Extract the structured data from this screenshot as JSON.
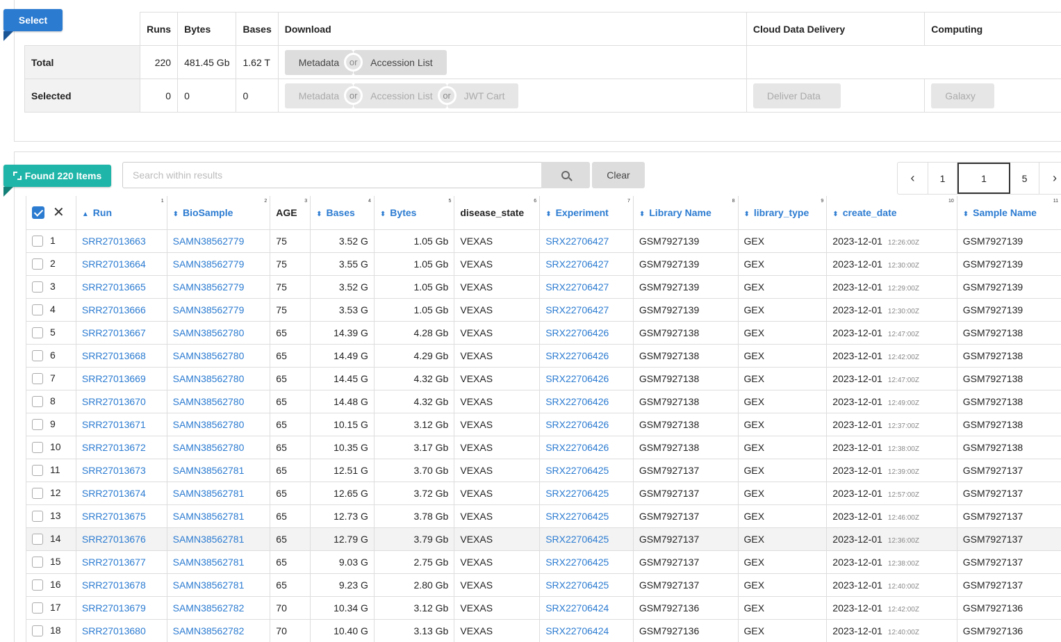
{
  "select_ribbon": "Select",
  "summary": {
    "headers": {
      "runs": "Runs",
      "bytes": "Bytes",
      "bases": "Bases",
      "download": "Download",
      "cloud": "Cloud Data Delivery",
      "computing": "Computing"
    },
    "total": {
      "label": "Total",
      "runs": "220",
      "bytes": "481.45 Gb",
      "bases": "1.62 T",
      "metadata": "Metadata",
      "or": "or",
      "accession": "Accession List"
    },
    "selected": {
      "label": "Selected",
      "runs": "0",
      "bytes": "0",
      "bases": "0",
      "metadata": "Metadata",
      "or1": "or",
      "accession": "Accession List",
      "or2": "or",
      "jwt": "JWT Cart",
      "deliver": "Deliver Data",
      "galaxy": "Galaxy"
    }
  },
  "found_ribbon": "Found 220 Items",
  "search": {
    "placeholder": "Search within results",
    "clear": "Clear"
  },
  "pager": {
    "prev": "‹",
    "first": "1",
    "current": "1",
    "last": "5",
    "next": "›"
  },
  "columns": [
    {
      "label": "Run",
      "num": "1"
    },
    {
      "label": "BioSample",
      "num": "2"
    },
    {
      "label": "AGE",
      "num": "3"
    },
    {
      "label": "Bases",
      "num": "4"
    },
    {
      "label": "Bytes",
      "num": "5"
    },
    {
      "label": "disease_state",
      "num": "6"
    },
    {
      "label": "Experiment",
      "num": "7"
    },
    {
      "label": "Library Name",
      "num": "8"
    },
    {
      "label": "library_type",
      "num": "9"
    },
    {
      "label": "create_date",
      "num": "10"
    },
    {
      "label": "Sample Name",
      "num": "11"
    }
  ],
  "rows": [
    {
      "n": "1",
      "run": "SRR27013663",
      "bio": "SAMN38562779",
      "age": "75",
      "bases": "3.52 G",
      "bytes": "1.05 Gb",
      "disease": "VEXAS",
      "exp": "SRX22706427",
      "lib": "GSM7927139",
      "type": "GEX",
      "date": "2023-12-01",
      "time": "12:26:00Z",
      "sample": "GSM7927139"
    },
    {
      "n": "2",
      "run": "SRR27013664",
      "bio": "SAMN38562779",
      "age": "75",
      "bases": "3.55 G",
      "bytes": "1.05 Gb",
      "disease": "VEXAS",
      "exp": "SRX22706427",
      "lib": "GSM7927139",
      "type": "GEX",
      "date": "2023-12-01",
      "time": "12:30:00Z",
      "sample": "GSM7927139"
    },
    {
      "n": "3",
      "run": "SRR27013665",
      "bio": "SAMN38562779",
      "age": "75",
      "bases": "3.52 G",
      "bytes": "1.05 Gb",
      "disease": "VEXAS",
      "exp": "SRX22706427",
      "lib": "GSM7927139",
      "type": "GEX",
      "date": "2023-12-01",
      "time": "12:29:00Z",
      "sample": "GSM7927139"
    },
    {
      "n": "4",
      "run": "SRR27013666",
      "bio": "SAMN38562779",
      "age": "75",
      "bases": "3.53 G",
      "bytes": "1.05 Gb",
      "disease": "VEXAS",
      "exp": "SRX22706427",
      "lib": "GSM7927139",
      "type": "GEX",
      "date": "2023-12-01",
      "time": "12:30:00Z",
      "sample": "GSM7927139"
    },
    {
      "n": "5",
      "run": "SRR27013667",
      "bio": "SAMN38562780",
      "age": "65",
      "bases": "14.39 G",
      "bytes": "4.28 Gb",
      "disease": "VEXAS",
      "exp": "SRX22706426",
      "lib": "GSM7927138",
      "type": "GEX",
      "date": "2023-12-01",
      "time": "12:47:00Z",
      "sample": "GSM7927138"
    },
    {
      "n": "6",
      "run": "SRR27013668",
      "bio": "SAMN38562780",
      "age": "65",
      "bases": "14.49 G",
      "bytes": "4.29 Gb",
      "disease": "VEXAS",
      "exp": "SRX22706426",
      "lib": "GSM7927138",
      "type": "GEX",
      "date": "2023-12-01",
      "time": "12:42:00Z",
      "sample": "GSM7927138"
    },
    {
      "n": "7",
      "run": "SRR27013669",
      "bio": "SAMN38562780",
      "age": "65",
      "bases": "14.45 G",
      "bytes": "4.32 Gb",
      "disease": "VEXAS",
      "exp": "SRX22706426",
      "lib": "GSM7927138",
      "type": "GEX",
      "date": "2023-12-01",
      "time": "12:47:00Z",
      "sample": "GSM7927138"
    },
    {
      "n": "8",
      "run": "SRR27013670",
      "bio": "SAMN38562780",
      "age": "65",
      "bases": "14.48 G",
      "bytes": "4.32 Gb",
      "disease": "VEXAS",
      "exp": "SRX22706426",
      "lib": "GSM7927138",
      "type": "GEX",
      "date": "2023-12-01",
      "time": "12:49:00Z",
      "sample": "GSM7927138"
    },
    {
      "n": "9",
      "run": "SRR27013671",
      "bio": "SAMN38562780",
      "age": "65",
      "bases": "10.15 G",
      "bytes": "3.12 Gb",
      "disease": "VEXAS",
      "exp": "SRX22706426",
      "lib": "GSM7927138",
      "type": "GEX",
      "date": "2023-12-01",
      "time": "12:37:00Z",
      "sample": "GSM7927138"
    },
    {
      "n": "10",
      "run": "SRR27013672",
      "bio": "SAMN38562780",
      "age": "65",
      "bases": "10.35 G",
      "bytes": "3.17 Gb",
      "disease": "VEXAS",
      "exp": "SRX22706426",
      "lib": "GSM7927138",
      "type": "GEX",
      "date": "2023-12-01",
      "time": "12:38:00Z",
      "sample": "GSM7927138"
    },
    {
      "n": "11",
      "run": "SRR27013673",
      "bio": "SAMN38562781",
      "age": "65",
      "bases": "12.51 G",
      "bytes": "3.70 Gb",
      "disease": "VEXAS",
      "exp": "SRX22706425",
      "lib": "GSM7927137",
      "type": "GEX",
      "date": "2023-12-01",
      "time": "12:39:00Z",
      "sample": "GSM7927137"
    },
    {
      "n": "12",
      "run": "SRR27013674",
      "bio": "SAMN38562781",
      "age": "65",
      "bases": "12.65 G",
      "bytes": "3.72 Gb",
      "disease": "VEXAS",
      "exp": "SRX22706425",
      "lib": "GSM7927137",
      "type": "GEX",
      "date": "2023-12-01",
      "time": "12:57:00Z",
      "sample": "GSM7927137"
    },
    {
      "n": "13",
      "run": "SRR27013675",
      "bio": "SAMN38562781",
      "age": "65",
      "bases": "12.73 G",
      "bytes": "3.78 Gb",
      "disease": "VEXAS",
      "exp": "SRX22706425",
      "lib": "GSM7927137",
      "type": "GEX",
      "date": "2023-12-01",
      "time": "12:46:00Z",
      "sample": "GSM7927137"
    },
    {
      "n": "14",
      "run": "SRR27013676",
      "bio": "SAMN38562781",
      "age": "65",
      "bases": "12.79 G",
      "bytes": "3.79 Gb",
      "disease": "VEXAS",
      "exp": "SRX22706425",
      "lib": "GSM7927137",
      "type": "GEX",
      "date": "2023-12-01",
      "time": "12:36:00Z",
      "sample": "GSM7927137",
      "highlight": true
    },
    {
      "n": "15",
      "run": "SRR27013677",
      "bio": "SAMN38562781",
      "age": "65",
      "bases": "9.03 G",
      "bytes": "2.75 Gb",
      "disease": "VEXAS",
      "exp": "SRX22706425",
      "lib": "GSM7927137",
      "type": "GEX",
      "date": "2023-12-01",
      "time": "12:38:00Z",
      "sample": "GSM7927137"
    },
    {
      "n": "16",
      "run": "SRR27013678",
      "bio": "SAMN38562781",
      "age": "65",
      "bases": "9.23 G",
      "bytes": "2.80 Gb",
      "disease": "VEXAS",
      "exp": "SRX22706425",
      "lib": "GSM7927137",
      "type": "GEX",
      "date": "2023-12-01",
      "time": "12:40:00Z",
      "sample": "GSM7927137"
    },
    {
      "n": "17",
      "run": "SRR27013679",
      "bio": "SAMN38562782",
      "age": "70",
      "bases": "10.34 G",
      "bytes": "3.12 Gb",
      "disease": "VEXAS",
      "exp": "SRX22706424",
      "lib": "GSM7927136",
      "type": "GEX",
      "date": "2023-12-01",
      "time": "12:42:00Z",
      "sample": "GSM7927136"
    },
    {
      "n": "18",
      "run": "SRR27013680",
      "bio": "SAMN38562782",
      "age": "70",
      "bases": "10.40 G",
      "bytes": "3.13 Gb",
      "disease": "VEXAS",
      "exp": "SRX22706424",
      "lib": "GSM7927136",
      "type": "GEX",
      "date": "2023-12-01",
      "time": "12:40:00Z",
      "sample": "GSM7927136"
    }
  ]
}
